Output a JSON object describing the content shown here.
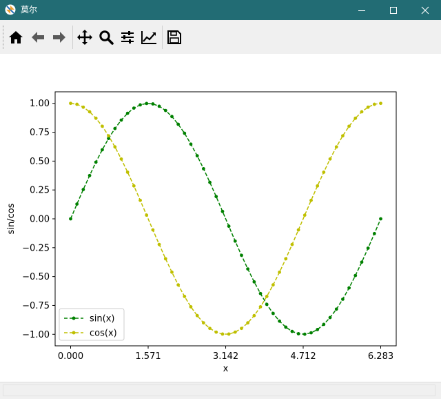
{
  "window": {
    "title": "莫尔",
    "controls": [
      "minimize-icon",
      "maximize-icon",
      "close-icon"
    ]
  },
  "toolbar": {
    "tools": [
      {
        "name": "home-button",
        "icon": "home-icon"
      },
      {
        "name": "back-button",
        "icon": "arrow-left-icon"
      },
      {
        "name": "forward-button",
        "icon": "arrow-right-icon"
      },
      {
        "name": "pan-button",
        "icon": "move-icon"
      },
      {
        "name": "zoom-button",
        "icon": "magnifier-icon"
      },
      {
        "name": "subplots-button",
        "icon": "sliders-icon"
      },
      {
        "name": "axes-button",
        "icon": "line-chart-icon"
      },
      {
        "name": "save-button",
        "icon": "floppy-disk-icon"
      }
    ]
  },
  "colors": {
    "titlebar": "#226c74",
    "sin": "#008000",
    "cos": "#bfbf00"
  },
  "chart_data": {
    "type": "line",
    "title": "",
    "xlabel": "x",
    "ylabel": "sin/cos",
    "xlim": [
      -0.314,
      6.597
    ],
    "ylim": [
      -1.1,
      1.1
    ],
    "xticks": [
      "0.000",
      "1.571",
      "3.142",
      "4.712",
      "6.283"
    ],
    "yticks": [
      "1.00",
      "0.75",
      "0.50",
      "0.25",
      "0.00",
      "−0.25",
      "−0.50",
      "−0.75",
      "−1.00"
    ],
    "grid": false,
    "legend_position": "lower-left",
    "series": [
      {
        "name": "sin(x)",
        "style": "dashed with point markers",
        "x": [
          0,
          0.128,
          0.256,
          0.385,
          0.513,
          0.641,
          0.769,
          0.898,
          1.026,
          1.154,
          1.282,
          1.411,
          1.539,
          1.667,
          1.795,
          1.924,
          2.052,
          2.18,
          2.308,
          2.436,
          2.565,
          2.693,
          2.821,
          2.949,
          3.078,
          3.206,
          3.334,
          3.462,
          3.59,
          3.719,
          3.847,
          3.975,
          4.103,
          4.232,
          4.36,
          4.488,
          4.616,
          4.744,
          4.873,
          5.001,
          5.129,
          5.257,
          5.386,
          5.514,
          5.642,
          5.77,
          5.899,
          6.027,
          6.155,
          6.283
        ],
        "y": [
          0,
          0.128,
          0.254,
          0.375,
          0.491,
          0.598,
          0.696,
          0.782,
          0.855,
          0.914,
          0.959,
          0.987,
          0.999,
          0.995,
          0.975,
          0.938,
          0.886,
          0.819,
          0.741,
          0.647,
          0.546,
          0.434,
          0.316,
          0.193,
          0.064,
          -0.064,
          -0.193,
          -0.316,
          -0.434,
          -0.546,
          -0.647,
          -0.741,
          -0.819,
          -0.886,
          -0.938,
          -0.975,
          -0.995,
          -0.999,
          -0.987,
          -0.959,
          -0.914,
          -0.855,
          -0.782,
          -0.696,
          -0.598,
          -0.491,
          -0.375,
          -0.254,
          -0.128,
          0
        ]
      },
      {
        "name": "cos(x)",
        "style": "dashed with point markers",
        "x": [
          0,
          0.128,
          0.256,
          0.385,
          0.513,
          0.641,
          0.769,
          0.898,
          1.026,
          1.154,
          1.282,
          1.411,
          1.539,
          1.667,
          1.795,
          1.924,
          2.052,
          2.18,
          2.308,
          2.436,
          2.565,
          2.693,
          2.821,
          2.949,
          3.078,
          3.206,
          3.334,
          3.462,
          3.59,
          3.719,
          3.847,
          3.975,
          4.103,
          4.232,
          4.36,
          4.488,
          4.616,
          4.744,
          4.873,
          5.001,
          5.129,
          5.257,
          5.386,
          5.514,
          5.642,
          5.77,
          5.899,
          6.027,
          6.155,
          6.283
        ],
        "y": [
          1,
          0.992,
          0.967,
          0.927,
          0.871,
          0.802,
          0.719,
          0.623,
          0.518,
          0.404,
          0.285,
          0.16,
          0.032,
          -0.096,
          -0.222,
          -0.346,
          -0.462,
          -0.572,
          -0.672,
          -0.762,
          -0.838,
          -0.901,
          -0.949,
          -0.981,
          -0.998,
          -0.998,
          -0.981,
          -0.949,
          -0.901,
          -0.838,
          -0.762,
          -0.672,
          -0.572,
          -0.462,
          -0.346,
          -0.222,
          -0.096,
          0.032,
          0.16,
          0.285,
          0.404,
          0.518,
          0.623,
          0.719,
          0.802,
          0.871,
          0.927,
          0.967,
          0.992,
          1
        ]
      }
    ]
  }
}
